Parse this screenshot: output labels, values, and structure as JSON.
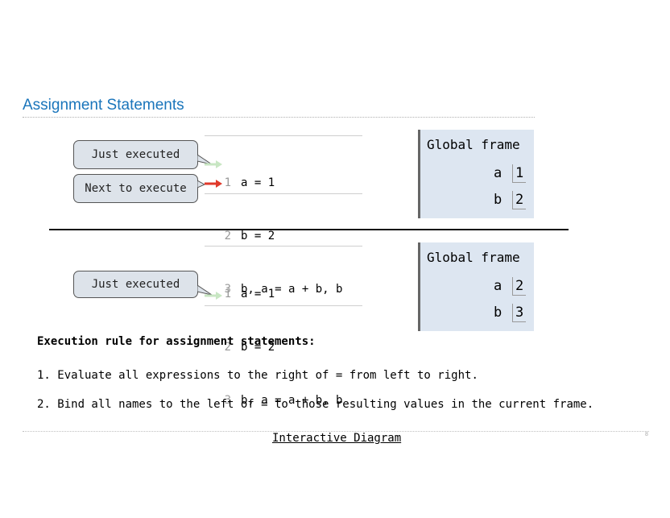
{
  "title": "Assignment Statements",
  "top": {
    "bubble_just_executed": "Just executed",
    "bubble_next_execute": "Next to execute",
    "code_lines": [
      {
        "num": "1",
        "text": "a = 1"
      },
      {
        "num": "2",
        "text": "b = 2"
      },
      {
        "num": "3",
        "text": "b, a = a + b, b"
      }
    ],
    "frame_title": "Global frame",
    "vars": [
      {
        "name": "a",
        "value": "1"
      },
      {
        "name": "b",
        "value": "2"
      }
    ]
  },
  "bottom": {
    "bubble_just_executed": "Just executed",
    "code_lines": [
      {
        "num": "1",
        "text": "a = 1"
      },
      {
        "num": "2",
        "text": "b = 2"
      },
      {
        "num": "3",
        "text": "b, a = a + b, b"
      }
    ],
    "frame_title": "Global frame",
    "vars": [
      {
        "name": "a",
        "value": "2"
      },
      {
        "name": "b",
        "value": "3"
      }
    ]
  },
  "rules": {
    "heading": "Execution rule for assignment statements:",
    "items": [
      "1. Evaluate all expressions to the right of = from left to right.",
      "2. Bind all names to the left of = to those resulting values in the current frame."
    ]
  },
  "link_text": "Interactive Diagram",
  "page_number": "8",
  "colors": {
    "title": "#1a75bb",
    "bubble_fill": "#dde3ea",
    "frame_fill": "#dde6f1",
    "arrow_just": "#c8e6c3",
    "arrow_next": "#e03a2b"
  }
}
